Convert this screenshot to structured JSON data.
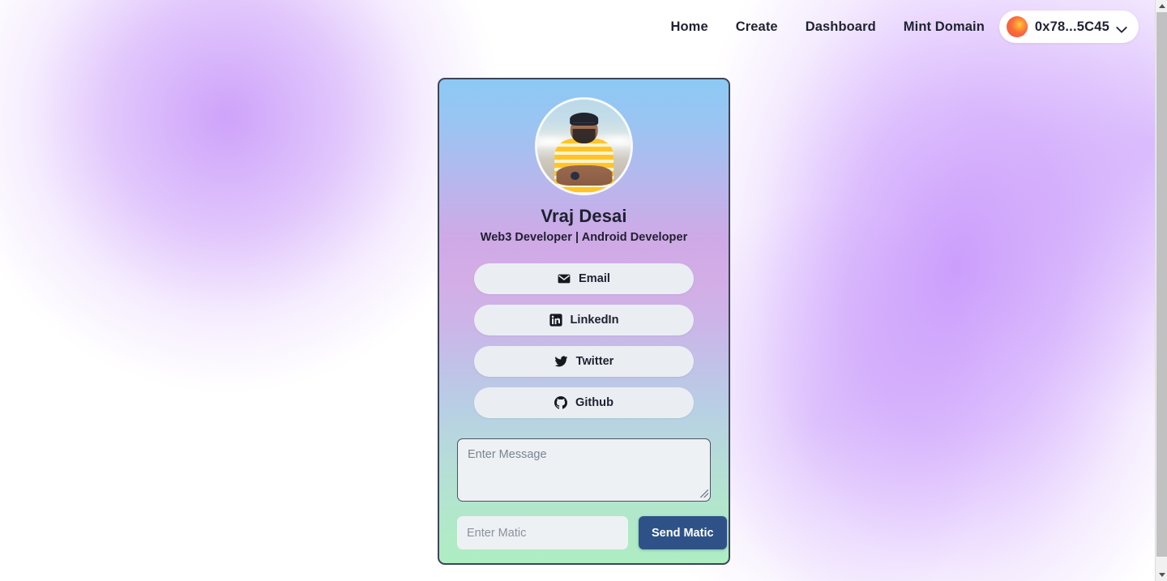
{
  "navbar": {
    "links": [
      {
        "label": "Home",
        "name": "nav-link-home"
      },
      {
        "label": "Create",
        "name": "nav-link-create"
      },
      {
        "label": "Dashboard",
        "name": "nav-link-dashboard"
      },
      {
        "label": "Mint Domain",
        "name": "nav-link-mint-domain"
      }
    ],
    "wallet": {
      "address": "0x78...5C45",
      "avatar_icon": "wallet-avatar-blob",
      "chevron_icon": "chevron-down-icon"
    }
  },
  "card": {
    "avatar_alt": "profile-photo",
    "name": "Vraj Desai",
    "tagline": "Web3 Developer | Android Developer",
    "socials": [
      {
        "label": "Email",
        "icon": "envelope-icon",
        "name": "social-button-email"
      },
      {
        "label": "LinkedIn",
        "icon": "linkedin-icon",
        "name": "social-button-linkedin"
      },
      {
        "label": "Twitter",
        "icon": "twitter-icon",
        "name": "social-button-twitter"
      },
      {
        "label": "Github",
        "icon": "github-icon",
        "name": "social-button-github"
      }
    ],
    "message": {
      "placeholder": "Enter Message",
      "value": ""
    },
    "matic": {
      "placeholder": "Enter Matic",
      "value": "",
      "send_label": "Send Matic"
    }
  },
  "colors": {
    "accent_purple": "#b06af7",
    "send_button": "#2e5288",
    "social_button_bg": "#eaeef3",
    "card_border": "#3c4459",
    "text_dark": "#1e2130",
    "wallet_avatar_orange": "#f4553f"
  }
}
